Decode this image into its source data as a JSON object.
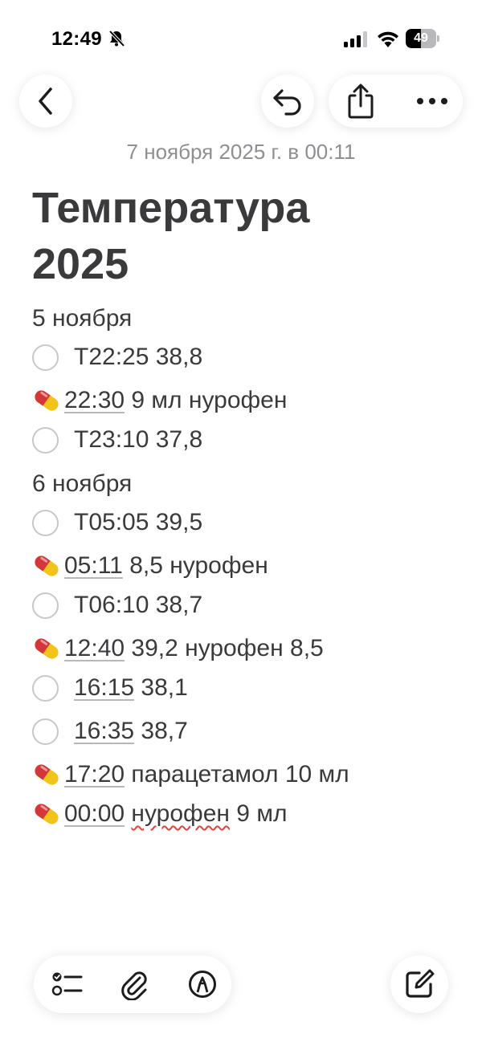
{
  "status_bar": {
    "time": "12:49",
    "battery_level": "49",
    "battery_fraction": 0.49,
    "icons": [
      "bell-slash-icon",
      "cellular-signal-icon",
      "wifi-icon",
      "battery-icon"
    ]
  },
  "toolbar": {
    "icons": [
      "chevron-left-icon",
      "undo-icon",
      "share-icon",
      "ellipsis-icon"
    ]
  },
  "note": {
    "date": "7 ноября 2025 г. в 00:11",
    "title_line1": "Температура",
    "title_line2": "2025",
    "lines": [
      {
        "type": "heading",
        "text": "5 ноября"
      },
      {
        "type": "check",
        "text": "Т22:25  38,8"
      },
      {
        "type": "med",
        "time": "22:30",
        "text": " 9 мл нурофен"
      },
      {
        "type": "check",
        "text": "Т23:10 37,8"
      },
      {
        "type": "heading",
        "text": "6 ноября"
      },
      {
        "type": "check",
        "text": "Т05:05 39,5"
      },
      {
        "type": "med",
        "time": "05:11",
        "text": " 8,5 нурофен"
      },
      {
        "type": "check",
        "text": "Т06:10 38,7"
      },
      {
        "type": "med",
        "time": "12:40",
        "text": " 39,2 нурофен 8,5"
      },
      {
        "type": "check",
        "time": "16:15",
        "text": " 38,1"
      },
      {
        "type": "check",
        "time": "16:35",
        "text": " 38,7"
      },
      {
        "type": "med",
        "time": "17:20",
        "text": " парацетамол 10 мл"
      },
      {
        "type": "med",
        "time": "00:00",
        "word": "нурофен",
        "text": " 9 мл"
      }
    ]
  },
  "bottom_toolbar": {
    "icons": [
      "checklist-icon",
      "paperclip-icon",
      "markup-pen-icon",
      "compose-icon"
    ]
  }
}
